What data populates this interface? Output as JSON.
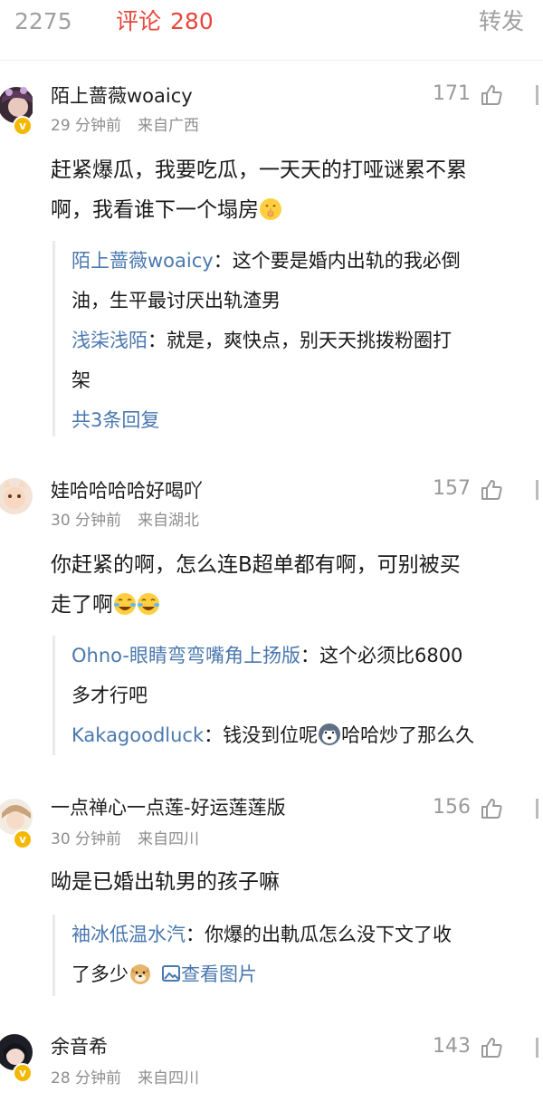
{
  "tabs": {
    "likes_count": "2275",
    "comments_label": "评论",
    "comments_count": "280",
    "reposts_label": "转发"
  },
  "colors": {
    "accent": "#e8463c",
    "link": "#4a78ae",
    "meta": "#8e8e8e",
    "badge": "#f5b800"
  },
  "comments": [
    {
      "username": "陌上蔷薇woaicy",
      "time": "29 分钟前",
      "location": "来自广西",
      "likes": "171",
      "text_lines": [
        "赶紧爆瓜，我要吃瓜，一天天的打哑谜累不累",
        "啊，我看谁下一个塌房"
      ],
      "replies": [
        {
          "author": "陌上蔷薇woaicy",
          "sep": "：",
          "lines": [
            "这个要是婚内出轨的我必倒",
            "油，生平最讨厌出轨渣男"
          ]
        },
        {
          "author": "浅柒浅陌",
          "sep": "：",
          "lines": [
            "就是，爽快点，别天天挑拨粉圈打",
            "架"
          ]
        }
      ],
      "more_replies": "共3条回复"
    },
    {
      "username": "娃哈哈哈哈好喝吖",
      "time": "30 分钟前",
      "location": "来自湖北",
      "likes": "157",
      "text_lines": [
        "你赶紧的啊，怎么连B超单都有啊，可别被买",
        "走了啊"
      ],
      "replies": [
        {
          "author": "Ohno-眼睛弯弯嘴角上扬版",
          "sep": "：",
          "lines": [
            "这个必须比6800",
            "多才行吧"
          ]
        },
        {
          "author": "Kakagoodluck",
          "sep": "：",
          "lines": [
            "钱没到位呢",
            "哈哈炒了那么久"
          ]
        }
      ]
    },
    {
      "username": "一点禅心一点莲-好运莲莲版",
      "time": "30 分钟前",
      "location": "来自四川",
      "likes": "156",
      "text_lines": [
        "呦是已婚出轨男的孩子嘛"
      ],
      "replies": [
        {
          "author": "袖冰低温水汽",
          "sep": "：",
          "lines": [
            "你爆的出軌瓜怎么没下文了收",
            "了多少"
          ],
          "image_link": "查看图片"
        }
      ]
    },
    {
      "username": "余音希",
      "time": "28 分钟前",
      "location": "来自四川",
      "likes": "143"
    }
  ]
}
